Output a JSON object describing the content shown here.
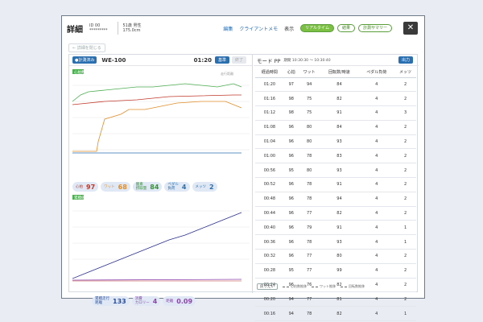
{
  "header": {
    "title": "詳細",
    "meta": [
      {
        "label": "ID 00",
        "value": "*********"
      },
      {
        "label": "51歳 男性",
        "value": "175.0cm"
      }
    ],
    "links": [
      "編集",
      "クライアントメモ",
      "表示"
    ],
    "pills": [
      "リアルタイム",
      "結果",
      "計測サマリー"
    ],
    "close": "✕",
    "back": "← 詳細を閉じる"
  },
  "left": {
    "tag": "●計測済み",
    "model": "WE-100",
    "time": "01:20",
    "btn1": "基準",
    "btn2": "終了",
    "chart1_label": "心拍数",
    "chart2_label": "累積値",
    "chart1_side_note": "走行距離",
    "badges1": [
      {
        "label": "心拍",
        "value": "97",
        "color": "#c0392b"
      },
      {
        "label": "ワット",
        "value": "68",
        "color": "#e08e2b"
      },
      {
        "label": "酸素\n摂取量",
        "value": "84",
        "color": "#3a8f3a"
      },
      {
        "label": "ペダル\n負荷",
        "value": "4",
        "color": "#2a6fb0"
      },
      {
        "label": "メッツ",
        "value": "2",
        "color": "#2a6fb0"
      }
    ],
    "badges2": [
      {
        "label": "累積走行\n距離",
        "value": "133",
        "color": "#2a4fa0"
      },
      {
        "label": "消費\nカロリー",
        "value": "4",
        "color": "#8e44ad"
      },
      {
        "label": "距離",
        "value": "0.09",
        "color": "#8e44ad"
      }
    ]
  },
  "right": {
    "title": "モード PP",
    "period": "期間 10:30:30 〜 10:30:40",
    "btn": "出力",
    "columns": [
      "経過時間",
      "心拍",
      "ワット",
      "回転数/時速",
      "ペダル負荷",
      "メッツ"
    ],
    "rows": [
      [
        "01:20",
        "97",
        "94",
        "84",
        "4",
        "2"
      ],
      [
        "01:16",
        "98",
        "75",
        "82",
        "4",
        "2"
      ],
      [
        "01:12",
        "98",
        "75",
        "91",
        "4",
        "3"
      ],
      [
        "01:08",
        "96",
        "80",
        "84",
        "4",
        "2"
      ],
      [
        "01:04",
        "96",
        "80",
        "93",
        "4",
        "2"
      ],
      [
        "01:00",
        "96",
        "78",
        "83",
        "4",
        "2"
      ],
      [
        "00:56",
        "95",
        "80",
        "93",
        "4",
        "2"
      ],
      [
        "00:52",
        "96",
        "78",
        "91",
        "4",
        "2"
      ],
      [
        "00:48",
        "96",
        "78",
        "94",
        "4",
        "2"
      ],
      [
        "00:44",
        "96",
        "77",
        "82",
        "4",
        "2"
      ],
      [
        "00:40",
        "96",
        "79",
        "91",
        "4",
        "1"
      ],
      [
        "00:36",
        "96",
        "78",
        "93",
        "4",
        "1"
      ],
      [
        "00:32",
        "96",
        "77",
        "80",
        "4",
        "2"
      ],
      [
        "00:28",
        "95",
        "77",
        "99",
        "4",
        "2"
      ],
      [
        "00:24",
        "96",
        "76",
        "82",
        "4",
        "2"
      ],
      [
        "00:20",
        "94",
        "77",
        "81",
        "4",
        "2"
      ],
      [
        "00:16",
        "94",
        "78",
        "82",
        "4",
        "1"
      ]
    ],
    "foot_btn": "戻りたい",
    "legend": [
      "心拍数推移",
      "ワット推移",
      "回転数推移"
    ]
  },
  "colors": {
    "green": "#4caf50",
    "red": "#c0392b",
    "orange": "#e08e2b",
    "blue": "#2a6fb0",
    "navy": "#2a2f8f",
    "purple": "#8e44ad"
  }
}
